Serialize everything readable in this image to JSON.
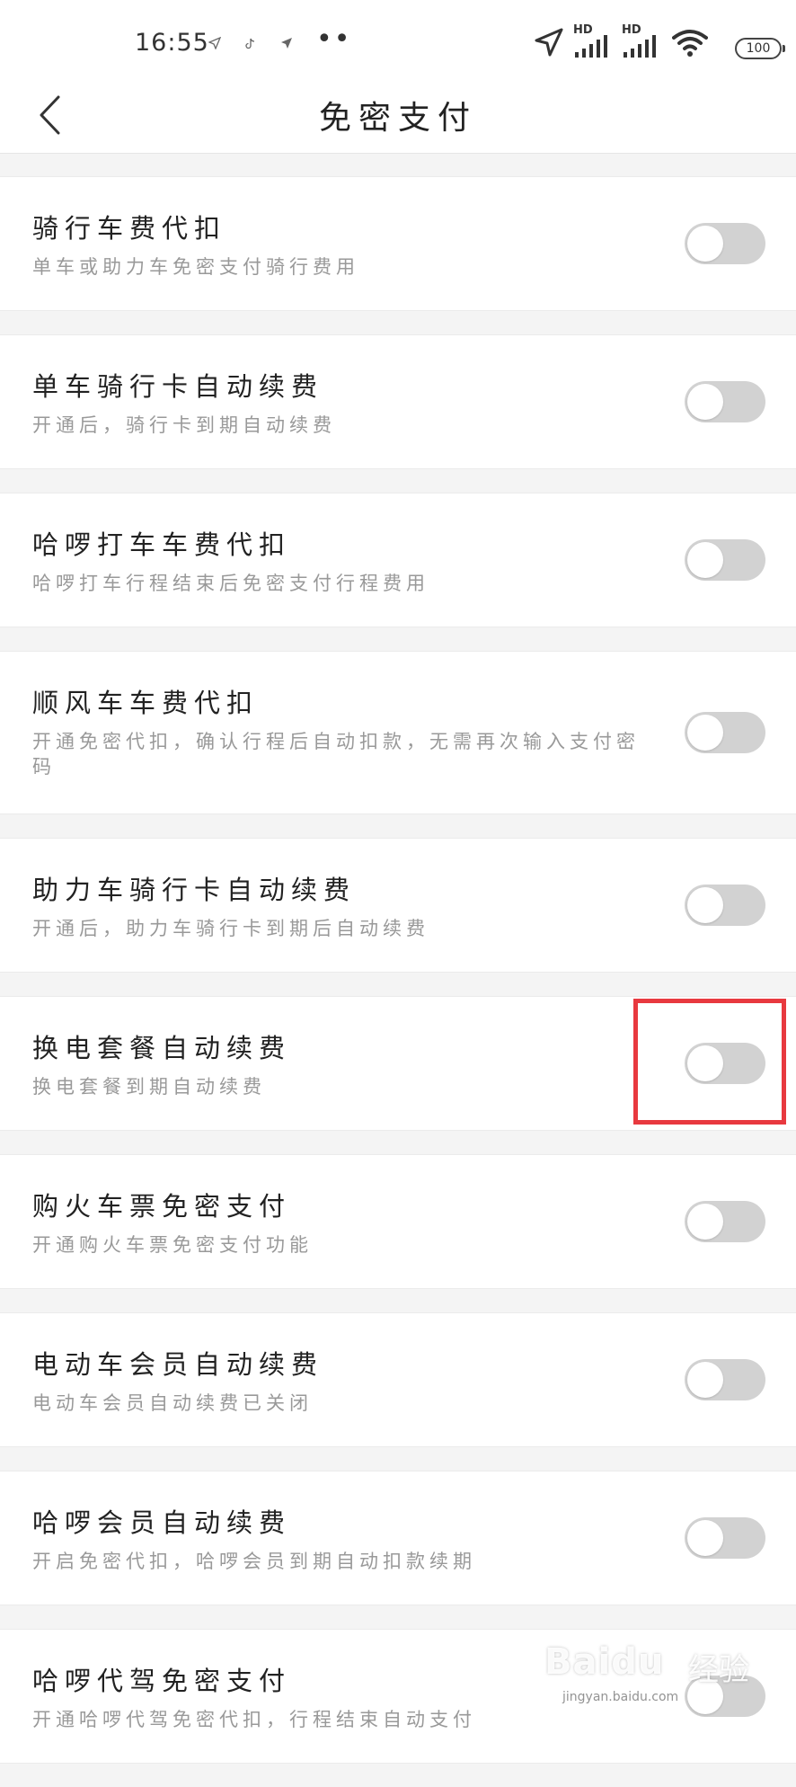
{
  "status_bar": {
    "time": "16:55",
    "notif_icons": [
      "navigation-arrow-icon",
      "tiktok-icon",
      "navigation-arrow-icon"
    ],
    "more_dots": "••",
    "hd_label": "HD",
    "battery": "100"
  },
  "nav": {
    "title": "免密支付"
  },
  "items": [
    {
      "title": "骑行车费代扣",
      "desc": "单车或助力车免密支付骑行费用",
      "enabled": false
    },
    {
      "title": "单车骑行卡自动续费",
      "desc": "开通后，骑行卡到期自动续费",
      "enabled": false
    },
    {
      "title": "哈啰打车车费代扣",
      "desc": "哈啰打车行程结束后免密支付行程费用",
      "enabled": false
    },
    {
      "title": "顺风车车费代扣",
      "desc": "开通免密代扣，确认行程后自动扣款，无需再次输入支付密码",
      "enabled": false
    },
    {
      "title": "助力车骑行卡自动续费",
      "desc": "开通后，助力车骑行卡到期后自动续费",
      "enabled": false
    },
    {
      "title": "换电套餐自动续费",
      "desc": "换电套餐到期自动续费",
      "enabled": false
    },
    {
      "title": "购火车票免密支付",
      "desc": "开通购火车票免密支付功能",
      "enabled": false
    },
    {
      "title": "电动车会员自动续费",
      "desc": "电动车会员自动续费已关闭",
      "enabled": false
    },
    {
      "title": "哈啰会员自动续费",
      "desc": "开启免密代扣，哈啰会员到期自动扣款续期",
      "enabled": false
    },
    {
      "title": "哈啰代驾免密支付",
      "desc": "开通哈啰代驾免密代扣，行程结束自动支付",
      "enabled": false
    }
  ],
  "watermark": {
    "logo": "Baidu",
    "text": "经验",
    "sub": "jingyan.baidu.com"
  },
  "colors": {
    "toggle_off": "#d2d2d2",
    "highlight": "#e8393f"
  }
}
